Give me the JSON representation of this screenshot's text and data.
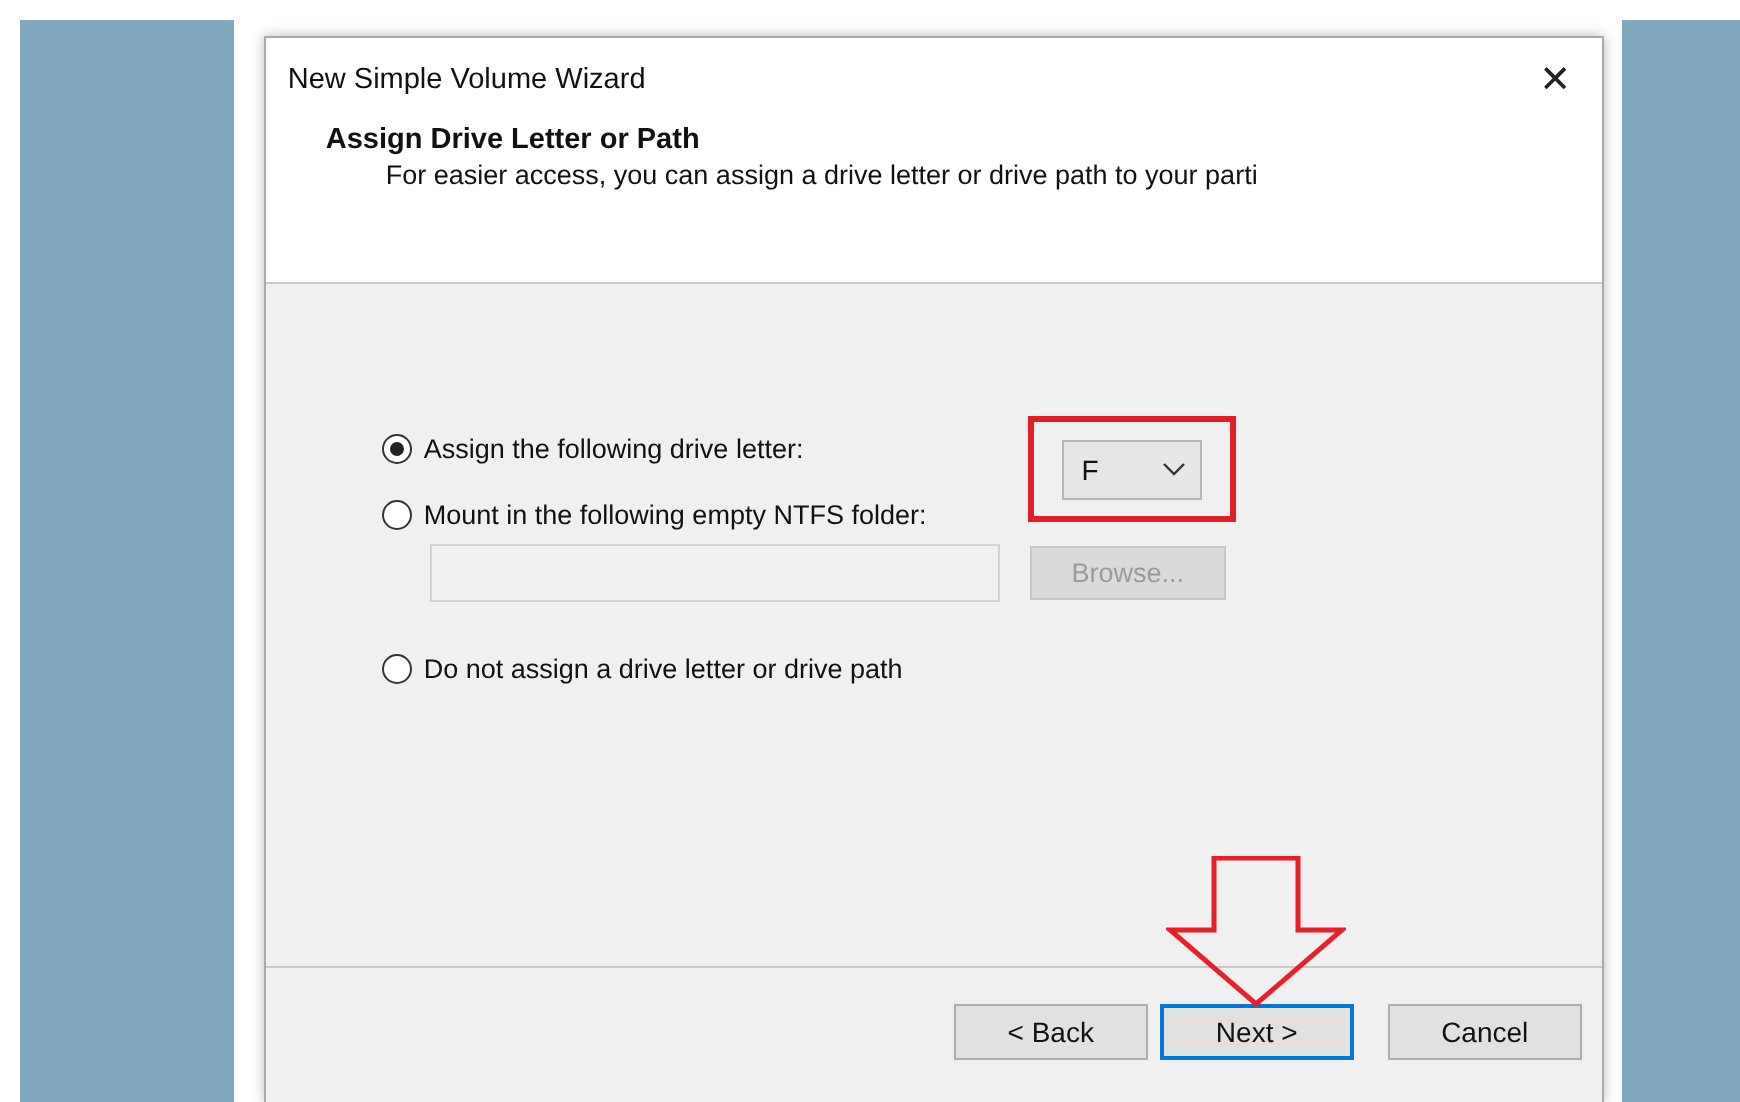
{
  "window": {
    "title": "New Simple Volume Wizard",
    "close": "✕"
  },
  "header": {
    "title": "Assign Drive Letter or Path",
    "subtitle": "For easier access, you can assign a drive letter or drive path to your parti"
  },
  "options": [
    {
      "kind": "letter",
      "label": "Assign the following drive letter:",
      "selected": true,
      "value": "F"
    },
    {
      "kind": "folder",
      "label": "Mount in the following empty NTFS folder:",
      "selected": false,
      "button": "Browse...",
      "disabled": true
    },
    {
      "kind": "none",
      "label": "Do not assign a drive letter or drive path",
      "selected": false
    }
  ],
  "buttons": [
    {
      "label": "< Back",
      "focused": false
    },
    {
      "label": "Next >",
      "focused": true
    },
    {
      "label": "Cancel",
      "focused": false
    }
  ]
}
